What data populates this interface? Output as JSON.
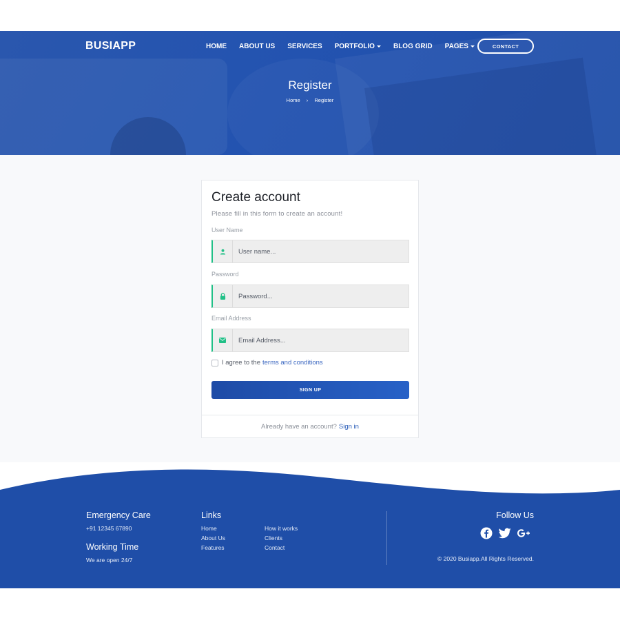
{
  "header": {
    "brand": "BUSIAPP",
    "nav": [
      {
        "label": "HOME",
        "caret": false
      },
      {
        "label": "ABOUT US",
        "caret": false
      },
      {
        "label": "SERVICES",
        "caret": false
      },
      {
        "label": "PORTFOLIO",
        "caret": true
      },
      {
        "label": "BLOG GRID",
        "caret": false
      },
      {
        "label": "PAGES",
        "caret": true
      }
    ],
    "contact_label": "CONTACT"
  },
  "hero": {
    "title": "Register",
    "breadcrumb": {
      "home": "Home",
      "separator": "›",
      "current": "Register"
    }
  },
  "form": {
    "title": "Create account",
    "subtitle": "Please fill in this form to create an account!",
    "fields": [
      {
        "label": "User Name",
        "placeholder": "User name...",
        "icon": "user-icon"
      },
      {
        "label": "Password",
        "placeholder": "Password...",
        "icon": "lock-icon"
      },
      {
        "label": "Email Address",
        "placeholder": "Email Address...",
        "icon": "envelope-icon"
      }
    ],
    "agree_text": "I agree to the",
    "terms_link": "terms and conditions",
    "submit_label": "SIGN UP",
    "signin_prompt": "Already have an account?",
    "signin_link": "Sign in"
  },
  "footer": {
    "emergency_title": "Emergency Care",
    "emergency_phone": "+91 12345 67890",
    "working_title": "Working Time",
    "working_text": "We are open 24/7",
    "links_title": "Links",
    "links_col1": [
      "Home",
      "About Us",
      "Features"
    ],
    "links_col2": [
      "How it works",
      "Clients",
      "Contact"
    ],
    "follow_title": "Follow Us",
    "socials": [
      "facebook-icon",
      "twitter-icon",
      "google-plus-icon"
    ],
    "copyright": "© 2020 Busiapp.All Rights Reserved."
  },
  "colors": {
    "primary": "#1f4ea8",
    "accent_green": "#21c087",
    "link": "#2a5db8"
  }
}
